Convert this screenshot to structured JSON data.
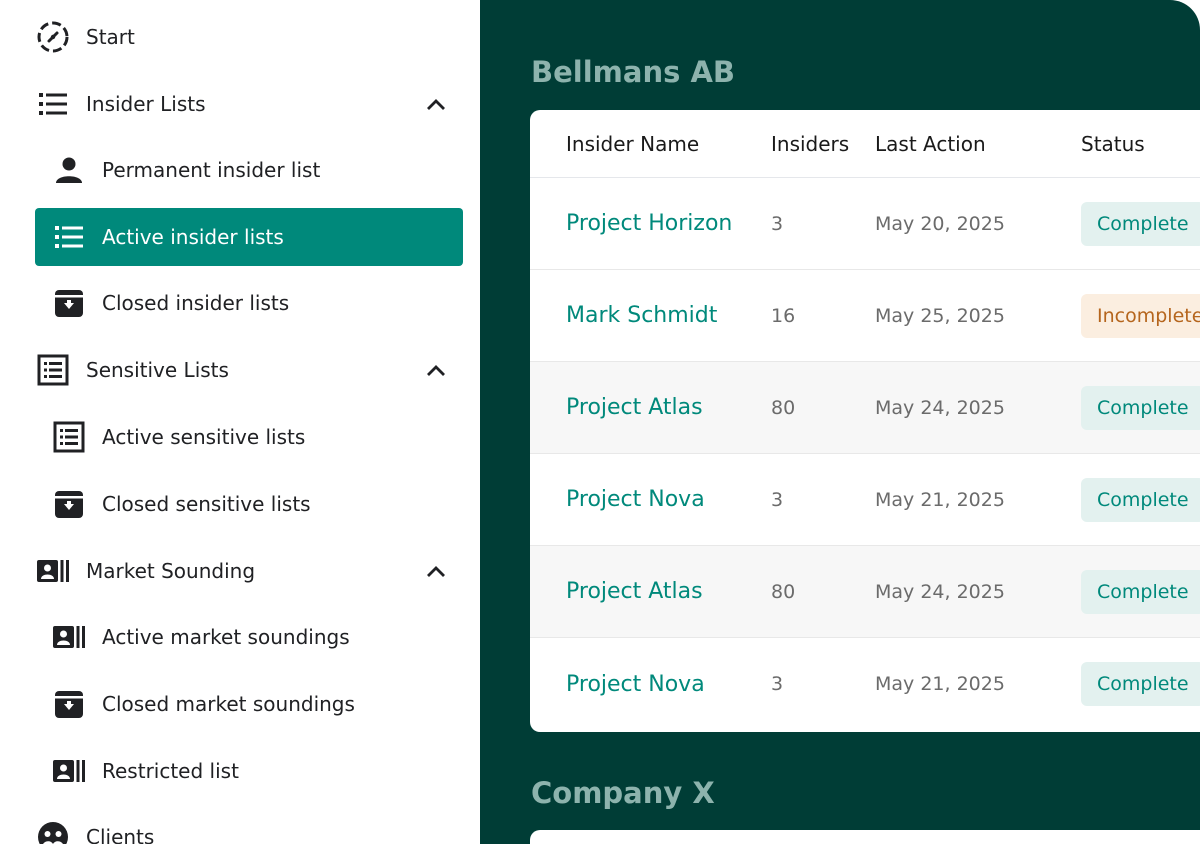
{
  "sidebar": {
    "start": {
      "label": "Start",
      "icon": "clock-dashed-icon"
    },
    "insider_lists": {
      "label": "Insider Lists",
      "icon": "list-icon",
      "items": [
        {
          "label": "Permanent insider list",
          "icon": "person-icon"
        },
        {
          "label": "Active insider lists",
          "icon": "list-icon",
          "active": true
        },
        {
          "label": "Closed insider lists",
          "icon": "archive-icon"
        }
      ]
    },
    "sensitive_lists": {
      "label": "Sensitive Lists",
      "icon": "list-box-icon",
      "items": [
        {
          "label": "Active sensitive lists",
          "icon": "list-box-icon"
        },
        {
          "label": "Closed sensitive lists",
          "icon": "archive-icon"
        }
      ]
    },
    "market_sounding": {
      "label": "Market Sounding",
      "icon": "id-card-icon",
      "items": [
        {
          "label": "Active market soundings",
          "icon": "id-card-icon"
        },
        {
          "label": "Closed market soundings",
          "icon": "archive-icon"
        },
        {
          "label": "Restricted list",
          "icon": "id-card-icon"
        }
      ]
    },
    "clients": {
      "label": "Clients",
      "icon": "clients-icon"
    }
  },
  "colors": {
    "accent": "#00897b",
    "main_bg": "#003d36",
    "complete_bg": "#e3f1ef",
    "incomplete_bg": "#fbeee0",
    "incomplete_text": "#b5651d"
  },
  "companies": [
    {
      "name": "Bellmans AB",
      "columns": [
        "Insider Name",
        "Insiders",
        "Last Action",
        "Status"
      ],
      "rows": [
        {
          "name": "Project Horizon",
          "insiders": "3",
          "last_action": "May 20, 2025",
          "status": "Complete"
        },
        {
          "name": "Mark Schmidt",
          "insiders": "16",
          "last_action": "May 25, 2025",
          "status": "Incomplete"
        },
        {
          "name": "Project Atlas",
          "insiders": "80",
          "last_action": "May 24, 2025",
          "status": "Complete"
        },
        {
          "name": "Project Nova",
          "insiders": "3",
          "last_action": "May 21, 2025",
          "status": "Complete"
        },
        {
          "name": "Project Atlas",
          "insiders": "80",
          "last_action": "May 24, 2025",
          "status": "Complete"
        },
        {
          "name": "Project Nova",
          "insiders": "3",
          "last_action": "May 21, 2025",
          "status": "Complete"
        }
      ]
    },
    {
      "name": "Company X"
    }
  ]
}
